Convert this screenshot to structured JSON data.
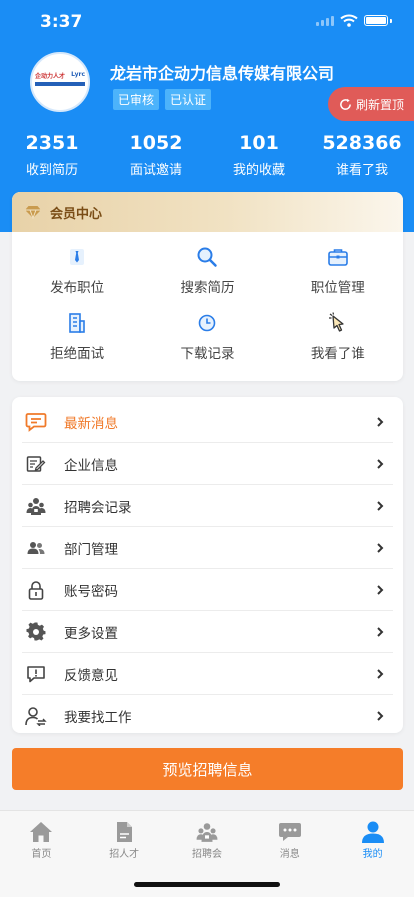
{
  "status_bar": {
    "time": "3:37"
  },
  "profile": {
    "logo_text_left": "企动力人才",
    "logo_text_right": "Lyrc",
    "company_name": "龙岩市企动力信息传媒有限公司",
    "tags": [
      "已审核",
      "已认证"
    ]
  },
  "refresh_button": {
    "label": "刷新置顶"
  },
  "stats": [
    {
      "value": "2351",
      "label": "收到简历"
    },
    {
      "value": "1052",
      "label": "面试邀请"
    },
    {
      "value": "101",
      "label": "我的收藏"
    },
    {
      "value": "528366",
      "label": "谁看了我"
    }
  ],
  "member_center": {
    "title": "会员中心",
    "items": [
      {
        "label": "发布职位",
        "icon": "tie-icon"
      },
      {
        "label": "搜索简历",
        "icon": "search-icon"
      },
      {
        "label": "职位管理",
        "icon": "briefcase-icon"
      },
      {
        "label": "拒绝面试",
        "icon": "building-icon"
      },
      {
        "label": "下载记录",
        "icon": "clock-icon"
      },
      {
        "label": "我看了谁",
        "icon": "pointer-icon"
      }
    ]
  },
  "menu": [
    {
      "label": "最新消息",
      "icon": "message-icon"
    },
    {
      "label": "企业信息",
      "icon": "edit-doc-icon"
    },
    {
      "label": "招聘会记录",
      "icon": "crowd-icon"
    },
    {
      "label": "部门管理",
      "icon": "people-icon"
    },
    {
      "label": "账号密码",
      "icon": "lock-icon"
    },
    {
      "label": "更多设置",
      "icon": "gear-icon"
    },
    {
      "label": "反馈意见",
      "icon": "feedback-icon"
    },
    {
      "label": "我要找工作",
      "icon": "user-switch-icon"
    }
  ],
  "preview_button": {
    "label": "预览招聘信息"
  },
  "tabbar": [
    {
      "label": "首页",
      "icon": "home-icon"
    },
    {
      "label": "招人才",
      "icon": "resume-icon"
    },
    {
      "label": "招聘会",
      "icon": "crowd-icon"
    },
    {
      "label": "消息",
      "icon": "chat-icon"
    },
    {
      "label": "我的",
      "icon": "user-icon",
      "active": true
    }
  ],
  "colors": {
    "primary": "#1a8df5",
    "accent": "#f57d29",
    "refresh": "#e05b58",
    "member_gold": "#7a4d16"
  }
}
